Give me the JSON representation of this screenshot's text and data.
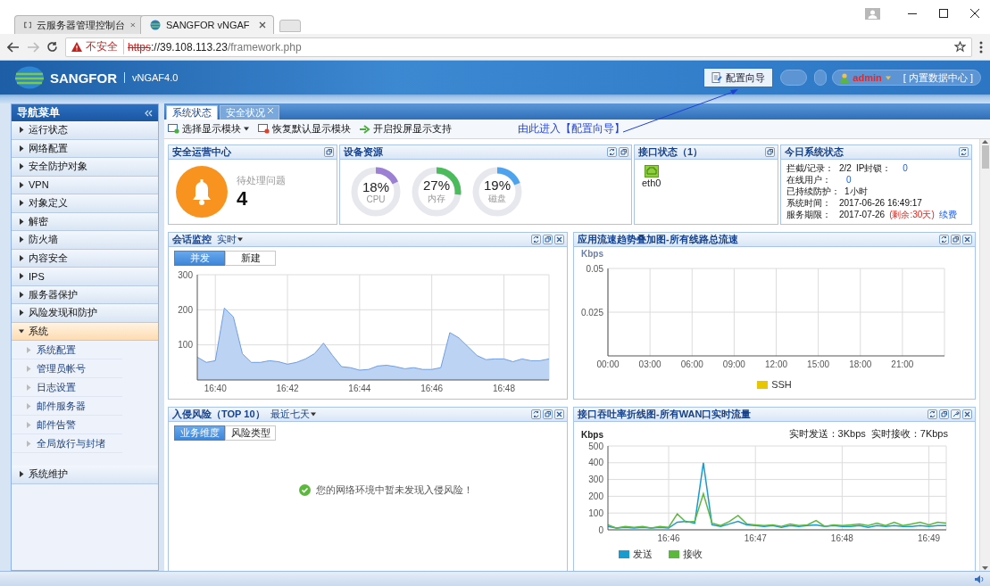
{
  "browser": {
    "tabs": [
      {
        "kind": "console",
        "title": "云服务器管理控制台",
        "selected": false
      },
      {
        "kind": "site",
        "title": "SANGFOR vNGAF",
        "selected": true
      }
    ],
    "security_label": "不安全",
    "url": {
      "scheme": "https",
      "host": "://39.108.113.23",
      "path": "/framework.php"
    }
  },
  "header": {
    "brand": "SANGFOR",
    "product": "vNGAF4.0",
    "wizard_button": "配置向导",
    "user": "admin",
    "datacenter": "[ 内置数据中心 ]"
  },
  "sidebar": {
    "title": "导航菜单",
    "items": [
      {
        "label": "运行状态",
        "expanded": false
      },
      {
        "label": "网络配置",
        "expanded": false
      },
      {
        "label": "安全防护对象",
        "expanded": false
      },
      {
        "label": "VPN",
        "expanded": false
      },
      {
        "label": "对象定义",
        "expanded": false
      },
      {
        "label": "解密",
        "expanded": false
      },
      {
        "label": "防火墙",
        "expanded": false
      },
      {
        "label": "内容安全",
        "expanded": false
      },
      {
        "label": "IPS",
        "expanded": false
      },
      {
        "label": "服务器保护",
        "expanded": false
      },
      {
        "label": "风险发现和防护",
        "expanded": false
      },
      {
        "label": "系统",
        "expanded": true,
        "children": [
          {
            "label": "系统配置"
          },
          {
            "label": "管理员帐号"
          },
          {
            "label": "日志设置"
          },
          {
            "label": "邮件服务器"
          },
          {
            "label": "邮件告警"
          },
          {
            "label": "全局放行与封堵"
          }
        ]
      },
      {
        "label": "系统维护",
        "expanded": false
      }
    ]
  },
  "main": {
    "tabs": [
      {
        "label": "系统状态",
        "selected": true,
        "closable": false
      },
      {
        "label": "安全状况",
        "selected": false,
        "closable": true
      }
    ],
    "toolbar": [
      {
        "kind": "dropdown",
        "label": "选择显示模块"
      },
      {
        "kind": "restore",
        "label": "恢复默认显示模块"
      },
      {
        "kind": "cast",
        "label": "开启投屏显示支持"
      }
    ],
    "annotation": "由此进入【配置向导】",
    "ops_center": {
      "title": "安全运营中心",
      "caption": "待处理问题",
      "count": "4"
    },
    "resources": {
      "title": "设备资源",
      "gauges": [
        {
          "value": "18%",
          "label": "CPU",
          "level": 0.18,
          "color": "#9b80d3"
        },
        {
          "value": "27%",
          "label": "内存",
          "level": 0.27,
          "color": "#4cbb5b"
        },
        {
          "value": "19%",
          "label": "磁盘",
          "level": 0.19,
          "color": "#4da3ee"
        }
      ]
    },
    "interfaces": {
      "title": "接口状态（1）",
      "ports": [
        "eth0"
      ]
    },
    "today": {
      "title": "今日系统状态",
      "rows": [
        {
          "label": "拦截/记录：",
          "value": "2/2",
          "extra_label": "IP封锁：",
          "extra_count": "0"
        },
        {
          "label": "在线用户：",
          "count": "0"
        },
        {
          "label": "已持续防护：",
          "value": "1小时"
        },
        {
          "label": "系统时间：",
          "value": "2017-06-26 16:49:17"
        },
        {
          "label": "服务期限：",
          "value": "2017-07-26",
          "remaining": "(剩余:30天)",
          "link": "续费"
        }
      ]
    },
    "sessions": {
      "title": "会话监控",
      "range": "实时",
      "modes": [
        {
          "label": "并发",
          "selected": true
        },
        {
          "label": "新建",
          "selected": false
        }
      ],
      "chart_data": {
        "type": "area",
        "grid": true,
        "ylim": [
          0,
          300
        ],
        "yticks": [
          100,
          200,
          300
        ],
        "categories": [
          null,
          null,
          "16:40",
          null,
          null,
          null,
          null,
          null,
          null,
          null,
          "16:42",
          null,
          null,
          null,
          null,
          null,
          null,
          null,
          "16:44",
          null,
          null,
          null,
          null,
          null,
          null,
          null,
          "16:46",
          null,
          null,
          null,
          null,
          null,
          null,
          null,
          "16:48",
          null,
          null,
          null,
          null,
          null
        ],
        "values": [
          65,
          50,
          55,
          205,
          180,
          75,
          50,
          50,
          55,
          52,
          45,
          50,
          60,
          75,
          105,
          70,
          38,
          35,
          28,
          30,
          40,
          42,
          38,
          32,
          35,
          30,
          30,
          35,
          135,
          120,
          95,
          70,
          58,
          60,
          60,
          52,
          60,
          55,
          55,
          60
        ]
      }
    },
    "app_traffic": {
      "title": "应用流速趋势叠加图-所有线路总流速",
      "chart_data": {
        "type": "line",
        "grid": true,
        "ylabel": "Kbps",
        "ylim": [
          0,
          0.05
        ],
        "yticks": [
          0.025,
          0.05
        ],
        "categories": [
          "00:00",
          "03:00",
          "06:00",
          "09:00",
          "12:00",
          "15:00",
          "18:00",
          "21:00"
        ],
        "series": [
          {
            "name": "SSH",
            "color": "#e8c700",
            "values": [
              null,
              null,
              null,
              null,
              null,
              null,
              null,
              null
            ]
          }
        ]
      }
    },
    "intrusion": {
      "title": "入侵风险（TOP 10）",
      "range": "最近七天",
      "modes": [
        {
          "label": "业务维度",
          "selected": true
        },
        {
          "label": "风险类型",
          "selected": false
        }
      ],
      "message": "您的网络环境中暂未发现入侵风险！"
    },
    "wan": {
      "title": "接口吞吐率折线图-所有WAN口实时流量",
      "send_label": "实时发送：",
      "send": "3Kbps",
      "recv_label": "实时接收：",
      "recv": "7Kbps",
      "chart_data": {
        "type": "line",
        "grid": true,
        "ylabel": "Kbps",
        "ylim": [
          0,
          500
        ],
        "yticks": [
          0,
          100,
          200,
          300,
          400,
          500
        ],
        "categories": [
          null,
          null,
          null,
          null,
          null,
          null,
          null,
          "16:46",
          null,
          null,
          null,
          null,
          null,
          null,
          null,
          null,
          null,
          "16:47",
          null,
          null,
          null,
          null,
          null,
          null,
          null,
          null,
          null,
          "16:48",
          null,
          null,
          null,
          null,
          null,
          null,
          null,
          null,
          null,
          "16:49",
          null,
          null
        ],
        "series": [
          {
            "name": "发送",
            "color": "#1a9bcf",
            "values": [
              20,
              10,
              15,
              10,
              15,
              10,
              15,
              10,
              45,
              50,
              40,
              400,
              30,
              20,
              35,
              50,
              30,
              25,
              20,
              25,
              15,
              25,
              20,
              25,
              30,
              20,
              25,
              20,
              20,
              25,
              15,
              25,
              20,
              25,
              20,
              20,
              25,
              20,
              25,
              25
            ]
          },
          {
            "name": "接收",
            "color": "#5cb83c",
            "values": [
              30,
              10,
              20,
              15,
              20,
              10,
              20,
              15,
              95,
              45,
              50,
              215,
              40,
              25,
              50,
              85,
              35,
              30,
              25,
              30,
              20,
              35,
              25,
              30,
              55,
              20,
              30,
              25,
              30,
              35,
              25,
              40,
              25,
              45,
              25,
              35,
              45,
              30,
              45,
              40
            ]
          }
        ]
      }
    }
  }
}
